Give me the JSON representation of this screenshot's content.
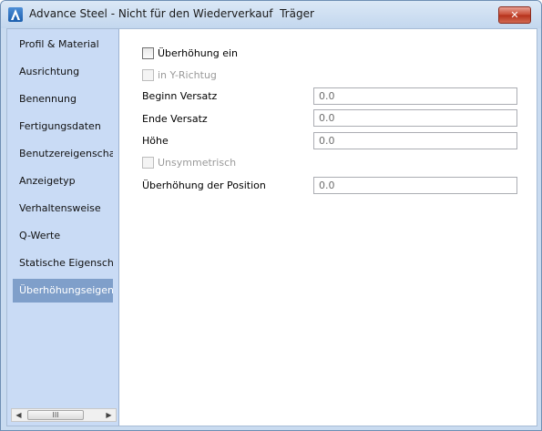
{
  "window": {
    "title": "Advance Steel - Nicht für den Wiederverkauf  Träger",
    "close_label": "✕",
    "app_icon": "advance-steel-logo"
  },
  "sidebar": {
    "items": [
      {
        "label": "Profil & Material",
        "selected": false
      },
      {
        "label": "Ausrichtung",
        "selected": false
      },
      {
        "label": "Benennung",
        "selected": false
      },
      {
        "label": "Fertigungsdaten",
        "selected": false
      },
      {
        "label": "Benutzereigenscha...",
        "selected": false
      },
      {
        "label": "Anzeigetyp",
        "selected": false
      },
      {
        "label": "Verhaltensweise",
        "selected": false
      },
      {
        "label": "Q-Werte",
        "selected": false
      },
      {
        "label": "Statische Eigensch...",
        "selected": false
      },
      {
        "label": "Überhöhungseigen...",
        "selected": true
      }
    ],
    "scroll_grip": "III",
    "scroll_left": "◀",
    "scroll_right": "▶"
  },
  "form": {
    "camber_checkbox": {
      "label": "Überhöhung ein",
      "checked": false,
      "enabled": true
    },
    "y_direction_checkbox": {
      "label": "in Y-Richtug",
      "checked": false,
      "enabled": false
    },
    "start_offset": {
      "label": "Beginn Versatz",
      "value": "0.0"
    },
    "end_offset": {
      "label": "Ende Versatz",
      "value": "0.0"
    },
    "height": {
      "label": "Höhe",
      "value": "0.0"
    },
    "asymmetric_checkbox": {
      "label": "Unsymmetrisch",
      "checked": false,
      "enabled": false
    },
    "camber_position": {
      "label": "Überhöhung der Position",
      "value": "0.0"
    }
  },
  "colors": {
    "sidebar_bg": "#c9dbf5",
    "selected_bg": "#7f9fca",
    "close_button": "#c74a32"
  }
}
